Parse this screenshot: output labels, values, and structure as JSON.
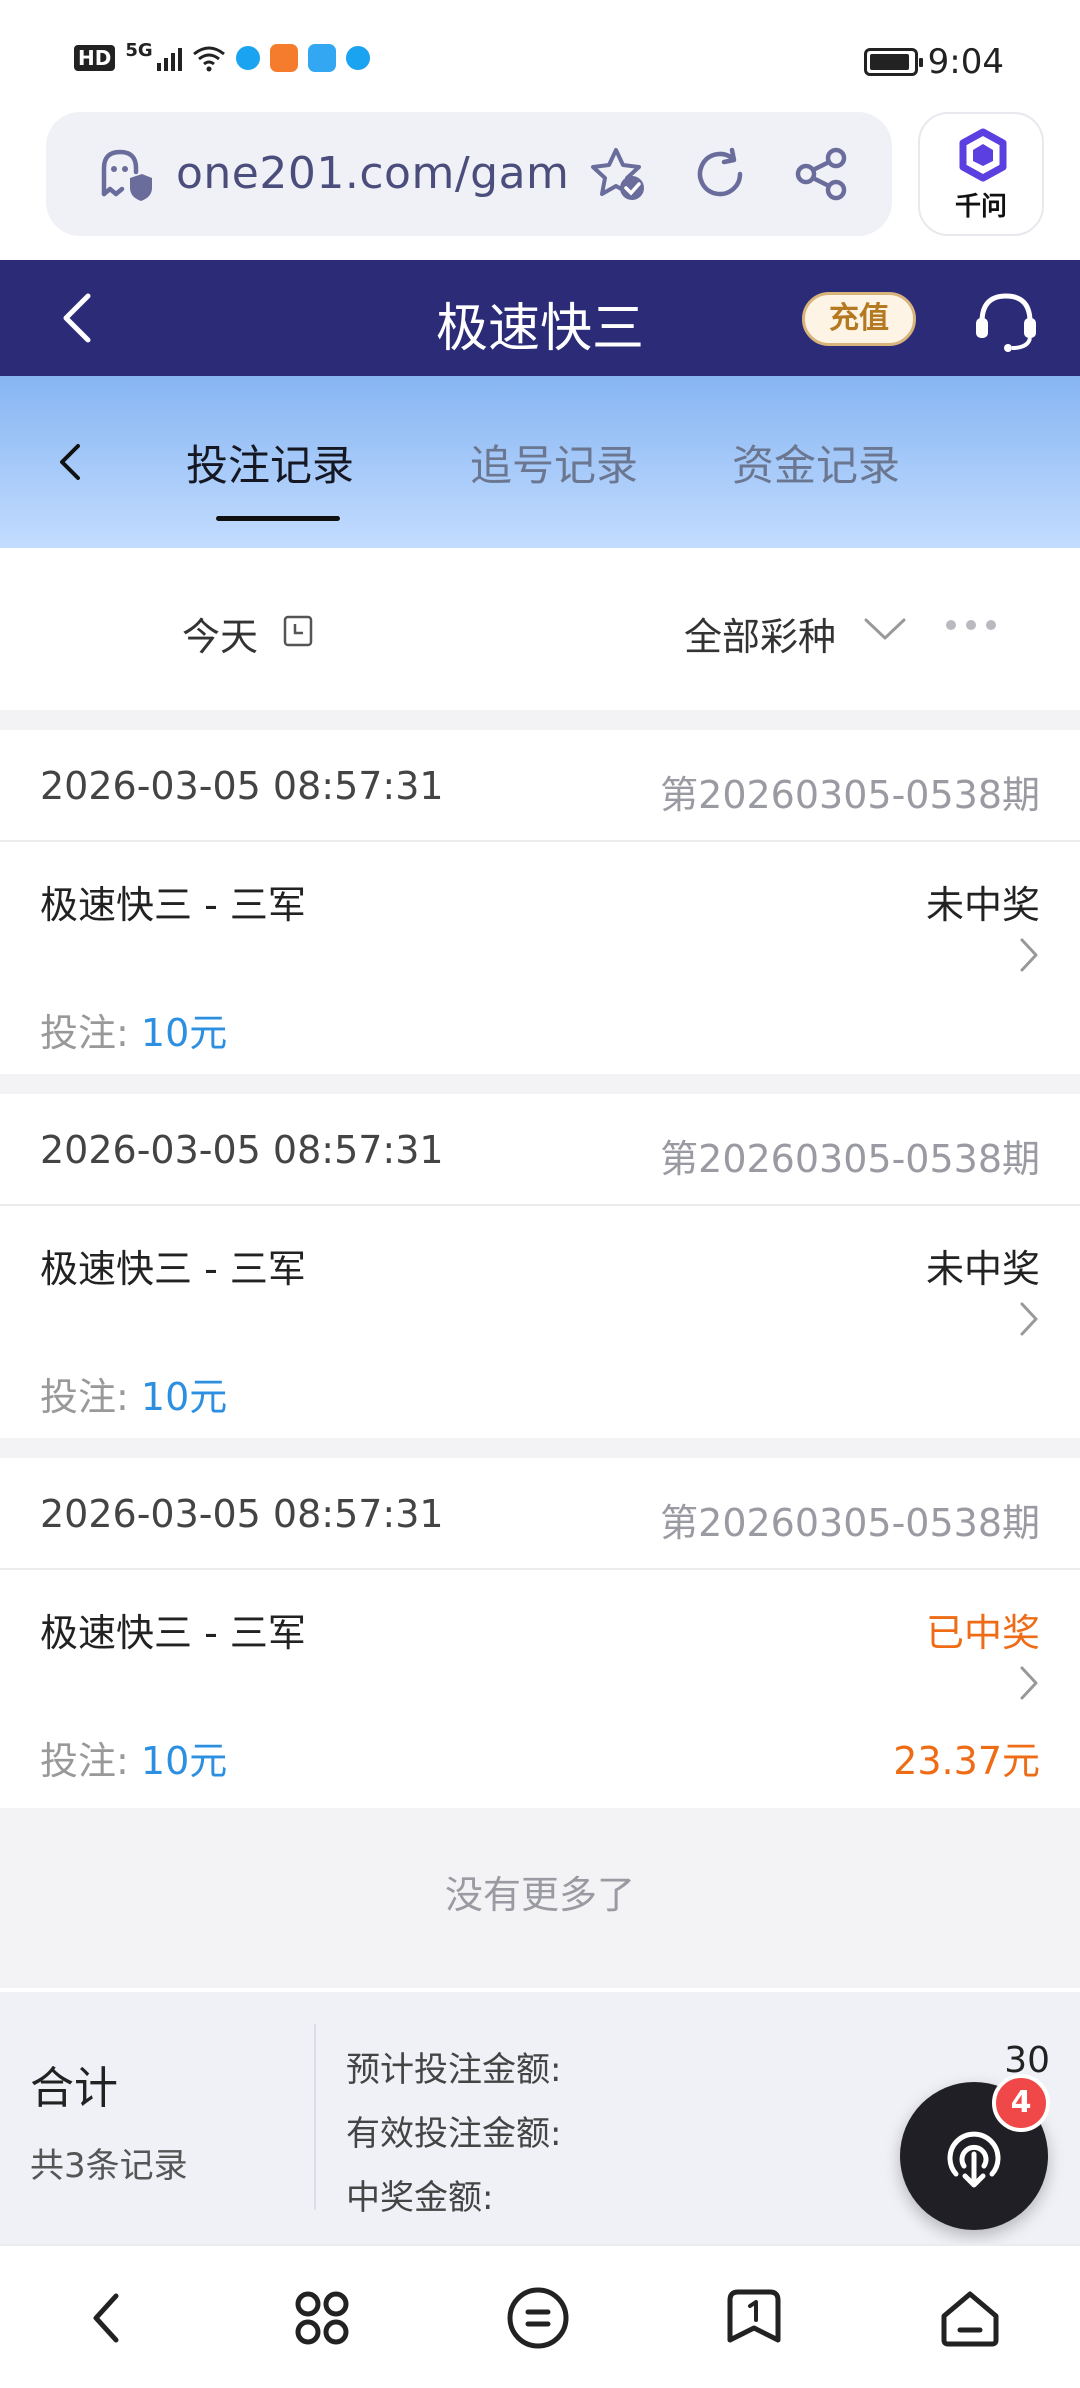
{
  "status_bar": {
    "hd": "HD",
    "network": "5G",
    "time": "9:04"
  },
  "browser": {
    "url": "one201.com/gam",
    "assistant_label": "千问"
  },
  "app_header": {
    "title": "极速快三",
    "recharge_label": "充值"
  },
  "tabs": [
    {
      "label": "投注记录",
      "active": true
    },
    {
      "label": "追号记录",
      "active": false
    },
    {
      "label": "资金记录",
      "active": false
    }
  ],
  "filters": {
    "date": "今天",
    "lottery": "全部彩种"
  },
  "records": [
    {
      "time": "2026-03-05 08:57:31",
      "issue": "第20260305-0538期",
      "name": "极速快三 - 三军",
      "status": "未中奖",
      "bet_label": "投注: ",
      "bet_amount": "10元",
      "prize": ""
    },
    {
      "time": "2026-03-05 08:57:31",
      "issue": "第20260305-0538期",
      "name": "极速快三 - 三军",
      "status": "未中奖",
      "bet_label": "投注: ",
      "bet_amount": "10元",
      "prize": ""
    },
    {
      "time": "2026-03-05 08:57:31",
      "issue": "第20260305-0538期",
      "name": "极速快三 - 三军",
      "status": "已中奖",
      "bet_label": "投注: ",
      "bet_amount": "10元",
      "prize": "23.37元"
    }
  ],
  "no_more": "没有更多了",
  "summary": {
    "title": "合计",
    "count": "共3条记录",
    "expected_label": "预计投注金额:",
    "expected_value": "30",
    "valid_label": "有效投注金额:",
    "prize_label": "中奖金额:"
  },
  "fab": {
    "badge": "4"
  },
  "colors": {
    "header": "#2c2b78",
    "win": "#ef6c16",
    "amount": "#2d8fe0",
    "recharge": "#b57a21"
  }
}
